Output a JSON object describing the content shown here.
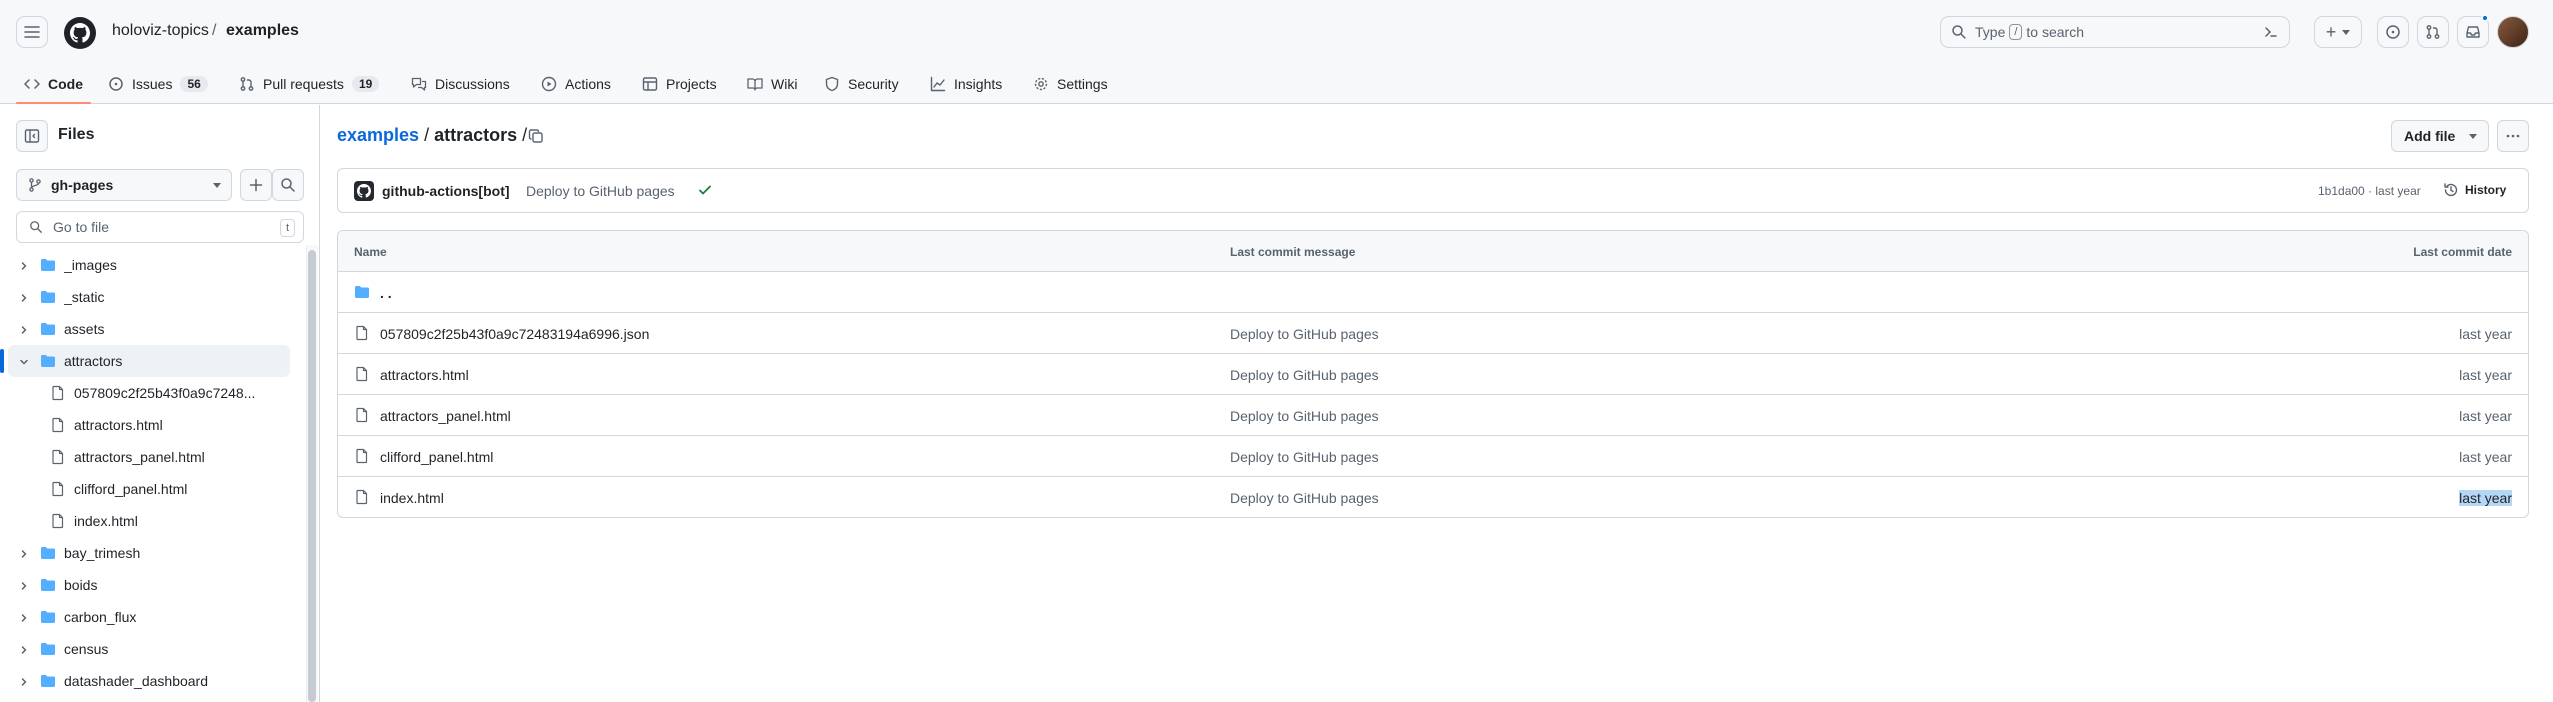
{
  "header": {
    "owner": "holoviz-topics",
    "separator": "/",
    "repo": "examples",
    "search_prefix": "Type",
    "search_key": "/",
    "search_suffix": "to search",
    "plus_label": "+"
  },
  "tabs": [
    {
      "label": "Code",
      "active": true
    },
    {
      "label": "Issues",
      "count": "56"
    },
    {
      "label": "Pull requests",
      "count": "19"
    },
    {
      "label": "Discussions"
    },
    {
      "label": "Actions"
    },
    {
      "label": "Projects"
    },
    {
      "label": "Wiki"
    },
    {
      "label": "Security"
    },
    {
      "label": "Insights"
    },
    {
      "label": "Settings"
    }
  ],
  "sidebar": {
    "title": "Files",
    "branch": "gh-pages",
    "goto_placeholder": "Go to file",
    "goto_key": "t",
    "tree": [
      {
        "label": "_images",
        "type": "folder",
        "expanded": false
      },
      {
        "label": "_static",
        "type": "folder",
        "expanded": false
      },
      {
        "label": "assets",
        "type": "folder",
        "expanded": false
      },
      {
        "label": "attractors",
        "type": "folder",
        "expanded": true,
        "selected": true
      },
      {
        "label": "057809c2f25b43f0a9c7248...",
        "type": "file"
      },
      {
        "label": "attractors.html",
        "type": "file"
      },
      {
        "label": "attractors_panel.html",
        "type": "file"
      },
      {
        "label": "clifford_panel.html",
        "type": "file"
      },
      {
        "label": "index.html",
        "type": "file"
      },
      {
        "label": "bay_trimesh",
        "type": "folder",
        "expanded": false
      },
      {
        "label": "boids",
        "type": "folder",
        "expanded": false
      },
      {
        "label": "carbon_flux",
        "type": "folder",
        "expanded": false
      },
      {
        "label": "census",
        "type": "folder",
        "expanded": false
      },
      {
        "label": "datashader_dashboard",
        "type": "folder",
        "expanded": false
      }
    ]
  },
  "main": {
    "breadcrumb_root": "examples",
    "breadcrumb_dir": "attractors",
    "breadcrumb_sep": "/",
    "add_file_label": "Add file",
    "commit": {
      "author": "github-actions[bot]",
      "message": "Deploy to GitHub pages",
      "meta": "1b1da00 · last year",
      "history_label": "History"
    },
    "table": {
      "headers": {
        "name": "Name",
        "message": "Last commit message",
        "date": "Last commit date"
      },
      "parent_label": ". .",
      "rows": [
        {
          "name": "057809c2f25b43f0a9c72483194a6996.json",
          "message": "Deploy to GitHub pages",
          "date": "last year"
        },
        {
          "name": "attractors.html",
          "message": "Deploy to GitHub pages",
          "date": "last year"
        },
        {
          "name": "attractors_panel.html",
          "message": "Deploy to GitHub pages",
          "date": "last year"
        },
        {
          "name": "clifford_panel.html",
          "message": "Deploy to GitHub pages",
          "date": "last year"
        },
        {
          "name": "index.html",
          "message": "Deploy to GitHub pages",
          "date": "last year",
          "highlighted": true
        }
      ]
    }
  },
  "colors": {
    "accent": "#0969da",
    "folder": "#54aeff",
    "tab_underline": "#fd8c73",
    "success": "#1a7f37"
  }
}
